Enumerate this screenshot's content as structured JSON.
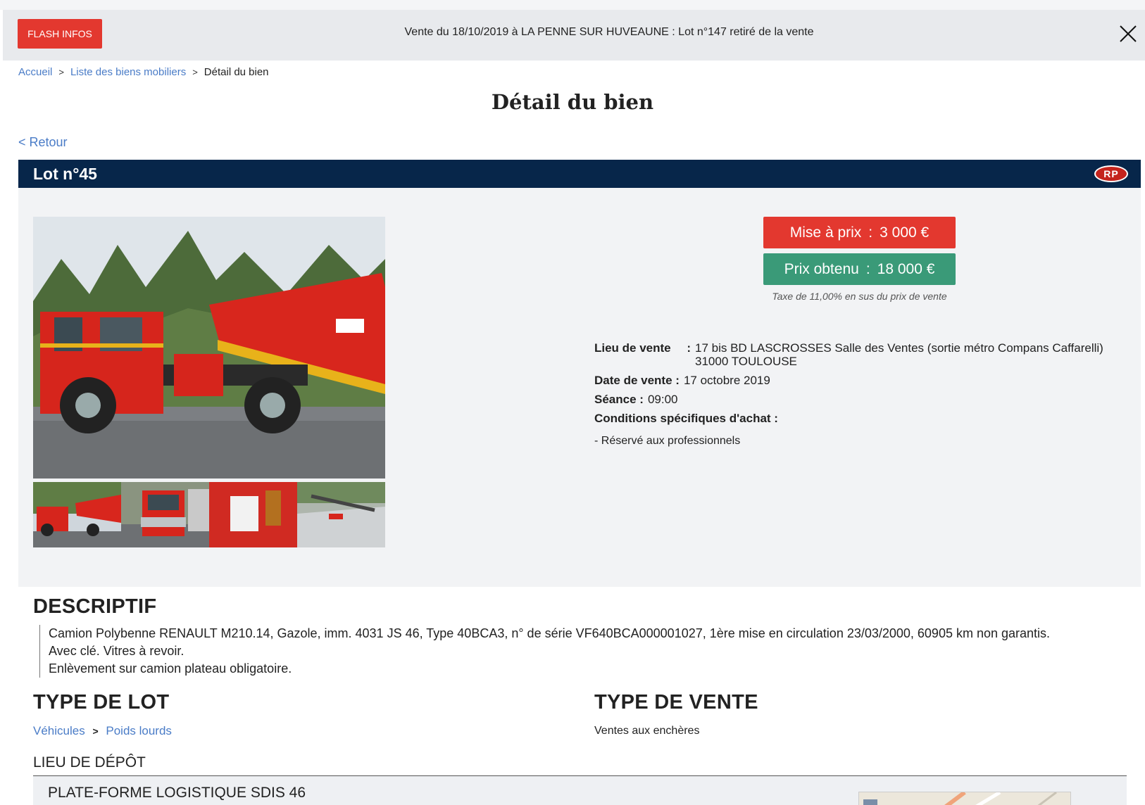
{
  "flash": {
    "button_label": "FLASH INFOS",
    "message": "Vente du 18/10/2019 à LA PENNE SUR HUVEAUNE : Lot n°147 retiré de la vente"
  },
  "breadcrumb": {
    "home": "Accueil",
    "list": "Liste des biens mobiliers",
    "current": "Détail du bien",
    "sep": ">"
  },
  "page": {
    "title": "Détail du bien",
    "back": "< Retour"
  },
  "lot": {
    "title": "Lot n°45",
    "badge": "RP"
  },
  "prices": {
    "mise_label": "Mise à prix",
    "mise_value": "3 000 €",
    "obtenu_label": "Prix obtenu",
    "obtenu_value": "18 000 €",
    "separator": ":",
    "tax_note": "Taxe de 11,00% en sus du prix de vente"
  },
  "info": {
    "lieu_label": "Lieu de vente",
    "lieu_line1": "17 bis BD LASCROSSES Salle des Ventes (sortie métro Compans Caffarelli)",
    "lieu_line2": "31000 TOULOUSE",
    "date_label": "Date de vente :",
    "date_value": "17 octobre 2019",
    "seance_label": "Séance :",
    "seance_value": "09:00",
    "conditions_label": "Conditions spécifiques d'achat :",
    "conditions_note": "- Réservé aux professionnels"
  },
  "descriptif": {
    "heading": "DESCRIPTIF",
    "line1": "Camion Polybenne RENAULT M210.14, Gazole, imm. 4031 JS 46, Type 40BCA3, n° de série VF640BCA000001027, 1ère mise en circulation 23/03/2000, 60905 km non garantis.",
    "line2": "Avec clé. Vitres à revoir.",
    "line3": "Enlèvement sur camion plateau obligatoire."
  },
  "type_lot": {
    "heading": "TYPE DE LOT",
    "cat1": "Véhicules",
    "cat2": "Poids lourds",
    "sep": ">"
  },
  "type_vente": {
    "heading": "TYPE DE VENTE",
    "value": "Ventes aux enchères"
  },
  "depot": {
    "heading": "LIEU DE DÉPÔT",
    "name": "PLATE-FORME LOGISTIQUE SDIS 46"
  },
  "colors": {
    "flash_red": "#e3382f",
    "navy": "#07264a",
    "green": "#3a9a78",
    "link": "#4a7cc7"
  }
}
